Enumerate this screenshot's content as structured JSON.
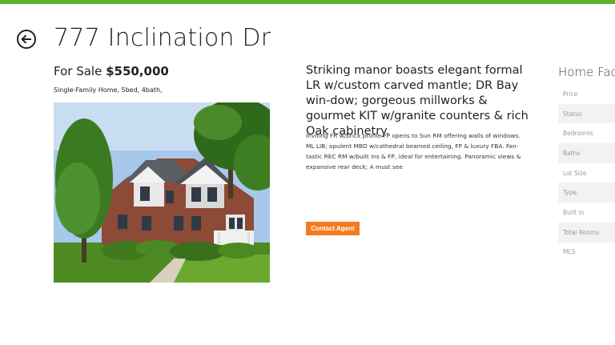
{
  "accent_color": "#5cb22c",
  "back_button": {
    "icon": "arrow-left-icon"
  },
  "listing": {
    "address": "777 Inclination Dr",
    "status_label": "For Sale",
    "price": "$550,000",
    "specs": "Single-Family Home, 5bed, 4bath,"
  },
  "photo": {
    "description": "house-exterior-photo"
  },
  "description": {
    "headline": "Striking manor boasts elegant formal LR w/custom carved mantle; DR Bay win-dow; gorgeous millworks & gourmet KIT w/granite counters & rich Oak cabinetry.",
    "body": "Inviting FR w/brick profile FP opens to Sun RM offering walls of windows. ML LIB; opulent MBD w/cathedral beamed ceiling, FP & luxury FBA. Fan-tastic REC RM w/built ins & FP, ideal for entertaining. Panoramic views & expansive rear deck; A must see"
  },
  "contact_button": {
    "label": "Contact Agent",
    "color": "#f47a20"
  },
  "home_facts": {
    "title": "Home Facts",
    "labels": [
      "Price",
      "Status",
      "Bedrooms",
      "Baths",
      "Lot Size",
      "Type",
      "Built in",
      "Total Rooms",
      "MLS"
    ]
  }
}
